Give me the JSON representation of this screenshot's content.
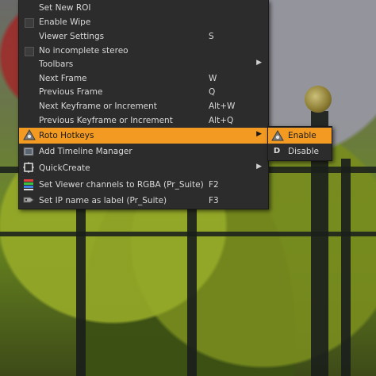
{
  "menu": {
    "items": [
      {
        "label": "Set New ROI",
        "shortcut": ""
      },
      {
        "label": "Enable Wipe",
        "shortcut": ""
      },
      {
        "label": "Viewer Settings",
        "shortcut": "S"
      },
      {
        "label": "No incomplete stereo",
        "shortcut": ""
      },
      {
        "label": "Toolbars",
        "shortcut": ""
      },
      {
        "label": "Next Frame",
        "shortcut": "W"
      },
      {
        "label": "Previous Frame",
        "shortcut": "Q"
      },
      {
        "label": "Next Keyframe or Increment",
        "shortcut": "Alt+W"
      },
      {
        "label": "Previous Keyframe or Increment",
        "shortcut": "Alt+Q"
      },
      {
        "label": "Roto Hotkeys",
        "shortcut": ""
      },
      {
        "label": "Add Timeline Manager",
        "shortcut": ""
      },
      {
        "label": "QuickCreate",
        "shortcut": ""
      },
      {
        "label": "Set Viewer channels to RGBA (Pr_Suite)",
        "shortcut": "F2"
      },
      {
        "label": "Set IP name as label (Pr_Suite)",
        "shortcut": "F3"
      }
    ],
    "submenu_arrow": "▶"
  },
  "submenu": {
    "items": [
      {
        "label": "Enable"
      },
      {
        "label": "Disable"
      }
    ],
    "disable_icon_glyph": "D"
  },
  "colors": {
    "highlight": "#f39a22",
    "menu_bg": "#2c2c2c",
    "text": "#d9d9d9"
  }
}
